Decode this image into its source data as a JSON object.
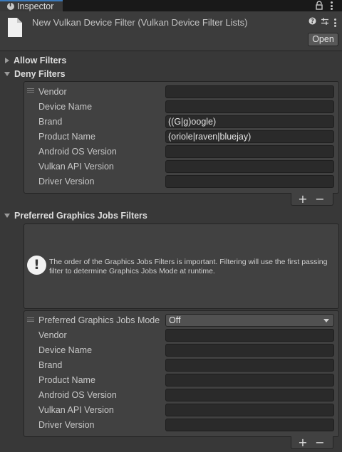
{
  "tab": {
    "title": "Inspector"
  },
  "header": {
    "asset_title": "New Vulkan Device Filter (Vulkan Device Filter Lists)",
    "open_label": "Open"
  },
  "sections": {
    "allow": {
      "label": "Allow Filters"
    },
    "deny": {
      "label": "Deny Filters"
    },
    "preferred": {
      "label": "Preferred Graphics Jobs Filters"
    }
  },
  "deny_rows": [
    {
      "label": "Vendor",
      "value": ""
    },
    {
      "label": "Device Name",
      "value": ""
    },
    {
      "label": "Brand",
      "value": "((G|g)oogle)"
    },
    {
      "label": "Product Name",
      "value": "(oriole|raven|bluejay)"
    },
    {
      "label": "Android OS Version",
      "value": ""
    },
    {
      "label": "Vulkan API Version",
      "value": ""
    },
    {
      "label": "Driver Version",
      "value": ""
    }
  ],
  "help": {
    "text": "The order of the Graphics Jobs Filters is important. Filtering will use the first passing filter to determine Graphics Jobs Mode at runtime."
  },
  "preferred": {
    "mode_label": "Preferred Graphics Jobs Mode",
    "mode_value": "Off",
    "rows": [
      {
        "label": "Vendor",
        "value": ""
      },
      {
        "label": "Device Name",
        "value": ""
      },
      {
        "label": "Brand",
        "value": ""
      },
      {
        "label": "Product Name",
        "value": ""
      },
      {
        "label": "Android OS Version",
        "value": ""
      },
      {
        "label": "Vulkan API Version",
        "value": ""
      },
      {
        "label": "Driver Version",
        "value": ""
      }
    ]
  },
  "buttons": {
    "plus": "+",
    "minus": "−"
  },
  "icons": [
    "info-icon",
    "lock-icon",
    "more-options-icon",
    "help-icon",
    "preset-icon",
    "file-icon",
    "warning-icon",
    "drag-handle-icon",
    "dropdown-caret-icon"
  ]
}
